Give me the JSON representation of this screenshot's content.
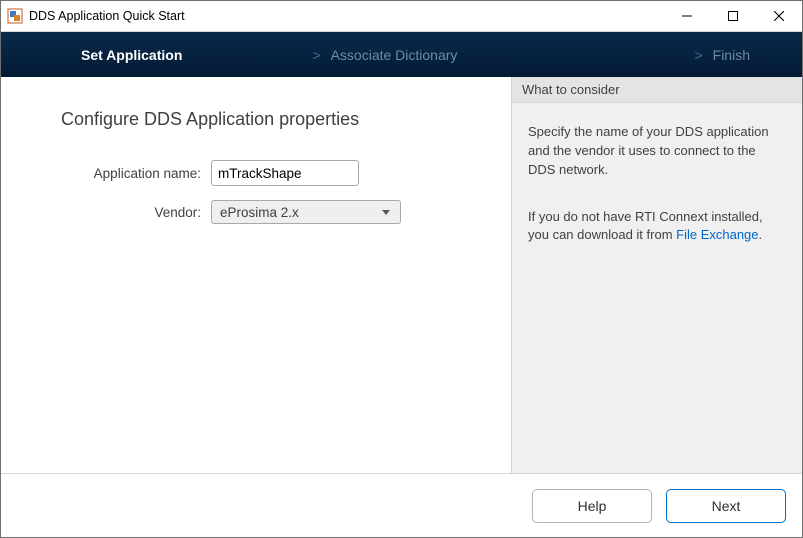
{
  "window": {
    "title": "DDS Application Quick Start"
  },
  "steps": {
    "setApplication": "Set Application",
    "associateDictionary": "Associate Dictionary",
    "finish": "Finish",
    "separator": ">"
  },
  "page": {
    "heading": "Configure DDS Application properties",
    "appNameLabel": "Application name:",
    "appNameValue": "mTrackShape",
    "vendorLabel": "Vendor:",
    "vendorValue": "eProsima 2.x"
  },
  "sidebar": {
    "header": "What to consider",
    "para1": "Specify the name of your DDS application and the vendor it uses to connect to the DDS network.",
    "para2a": "If you do not have RTI Connext installed, you can download it from ",
    "para2link": "File Exchange",
    "para2b": "."
  },
  "footer": {
    "help": "Help",
    "next": "Next"
  }
}
